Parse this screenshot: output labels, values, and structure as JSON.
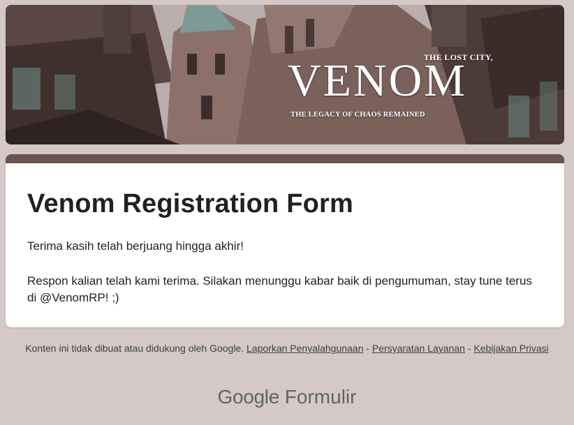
{
  "banner": {
    "tagline_top": "THE LOST CITY,",
    "title": "VENOM",
    "tagline_bottom": "THE LEGACY OF CHAOS REMAINED"
  },
  "form": {
    "accent_color": "#6b5450",
    "title": "Venom Registration Form",
    "message_line1": "Terima kasih telah berjuang hingga akhir!",
    "message_line2": "Respon kalian telah kami terima. Silakan menunggu kabar baik di pengumuman, stay tune terus di @VenomRP! ;)"
  },
  "footer": {
    "disclaimer": "Konten ini tidak dibuat atau didukung oleh Google.",
    "report_link": "Laporkan Penyalahgunaan",
    "separator": " - ",
    "terms_link": "Persyaratan Layanan",
    "privacy_link": "Kebijakan Privasi"
  },
  "brand": {
    "google": "Google",
    "product": "Formulir"
  }
}
